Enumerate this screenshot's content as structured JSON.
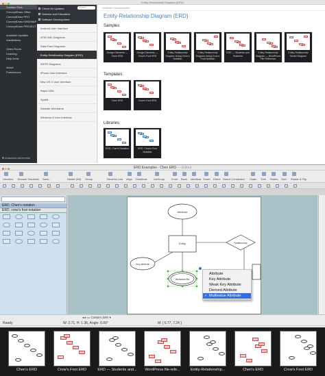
{
  "browser": {
    "title": "Entity-Relationship Diagram (ERD)",
    "sidebar": [
      {
        "label": "Solution Park",
        "active": true
      },
      {
        "label": "ConceptDraw Office",
        "active": false
      },
      {
        "label": "ConceptDraw PRO",
        "active": false
      },
      {
        "label": "ConceptDraw MINDMAP",
        "active": false
      },
      {
        "label": "ConceptDraw PROJECT",
        "active": false
      },
      {
        "label": "Available Updates",
        "active": false
      },
      {
        "label": "Installations",
        "active": false
      },
      {
        "label": "Video Room",
        "active": false
      },
      {
        "label": "Learning",
        "active": false
      },
      {
        "label": "Help Desk",
        "active": false
      },
      {
        "label": "About",
        "active": false
      },
      {
        "label": "Preferences",
        "active": false
      }
    ],
    "account": "Anastasia Alexeenko",
    "filter_check": "Check for updates",
    "filter_a": "Science and Education",
    "filter_b": "Software Development",
    "search_placeholder": "Search",
    "categories": [
      "Android User Interface",
      "ATM UML Diagrams",
      "Data Flow Diagrams",
      "Entity-Relationship Diagram (ERD)",
      "IDEF0 Diagrams",
      "iPhone User Interface",
      "Mac OS X User Interface",
      "Rapid UML",
      "SysML",
      "Website Wireframe",
      "Windows 8 User Interface"
    ],
    "active_category": 3,
    "breadcrumb": "Software Development",
    "samples_heading": "Samples",
    "samples": [
      "Design Elements — Chen ERD",
      "Design Elements — Crow's Foot ERD",
      "Entity-Relationship Diagram Using Chen's Notation",
      "Entity-Relationship Diagram Using Crow's Foot Notation",
      "ERD — Students and Teachers",
      "Entity-Relationship Diagram — WordPress File Reference",
      "Entity-Relationship Model Diagram"
    ],
    "templates_heading": "Templates",
    "templates": [
      "Chen ERD",
      "Crow's Foot ERD"
    ],
    "libraries_heading": "Libraries",
    "libraries": [
      "ERD, Chen's Notation",
      "ERD, Crow's Foot Notation"
    ]
  },
  "editor": {
    "title": "ERD Examples - Chen ERD",
    "title_suffix": "— Edited",
    "toolbar": [
      "Libraries",
      "Browse Solutions",
      "Save...",
      "Delete (Alt)",
      "Group",
      "Reverse Link",
      "Align",
      "Distribute",
      "UnGroup",
      "Front",
      "Back",
      "Identical",
      "Smart",
      "Direct",
      "Select Connected",
      "Chain",
      "Tree",
      "Rulers",
      "Grid",
      "Rotate & Flip"
    ],
    "libraries": [
      "ERD, Chen's notation",
      "ERD, crow's foot notation"
    ],
    "diagram": {
      "entity1": "Entity",
      "attribute1": "Attribute",
      "relationship": "Relationship",
      "attribute2": "Key attribute",
      "multivalue": "Multivalue Attr"
    },
    "context_menu": [
      "Attribute",
      "Key Attribute",
      "Weak Key Attribute",
      "Derived Attribute",
      "Multivalue Attribute"
    ],
    "context_selected": 4,
    "status": "Ready",
    "zoom": "Custom 34%",
    "dims": "W: 2.71,  H: 1.36,  Angle: 0.00°",
    "mouse": "M: [ 6.77, 7.24 ]"
  },
  "filmstrip": [
    "Chen's ERD",
    "Crow's Foot ERD",
    "ERD — Students and...",
    "WordPress file-refe...",
    "Entity-Relationship...",
    "Chen's ERD",
    "Crow's Foot ERD"
  ]
}
